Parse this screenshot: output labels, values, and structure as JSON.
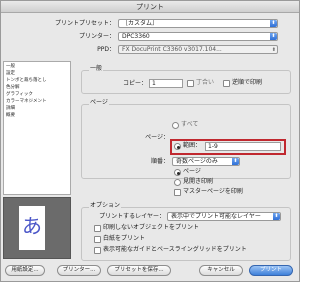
{
  "window": {
    "title": "プリント"
  },
  "header": {
    "preset_label": "プリントプリセット：",
    "preset_value": "［カスタム］",
    "printer_label": "プリンター：",
    "printer_value": "DPC3360",
    "ppd_label": "PPD：",
    "ppd_value": "FX DocuPrint C3360 v3017.104..."
  },
  "sidebar": {
    "items": [
      "一般",
      "設定",
      "トンボと裁ち落とし",
      "色分解",
      "グラフィック",
      "カラーマネジメント",
      "詳細",
      "概要"
    ]
  },
  "preview": {
    "glyph": "あ"
  },
  "general": {
    "title": "一般",
    "copies_label": "コピー：",
    "copies_value": "1",
    "collate_label": "丁合い",
    "reverse_label": "逆順で印刷"
  },
  "pages": {
    "title": "ページ",
    "pages_label": "ページ：",
    "all_label": "すべて",
    "range_label": "範囲：",
    "range_value": "1-9",
    "order_label": "順番：",
    "order_value": "奇数ページのみ",
    "page_option": "ページ",
    "spread_option": "見開き印刷",
    "master_label": "マスターページを印刷"
  },
  "options": {
    "title": "オプション",
    "layers_label": "プリントするレイヤー：",
    "layers_value": "表示中でプリント可能なレイヤー",
    "nonprint_label": "印刷しないオブジェクトをプリント",
    "white_label": "白紙をプリント",
    "guides_label": "表示可能なガイドとベースライングリッドをプリント"
  },
  "footer": {
    "page_setup": "用紙設定...",
    "printer": "プリンター...",
    "save_preset": "プリセットを保存...",
    "cancel": "キャンセル",
    "print": "プリント"
  },
  "colors": {
    "highlight": "#c0282f",
    "accent": "#3f80da"
  }
}
